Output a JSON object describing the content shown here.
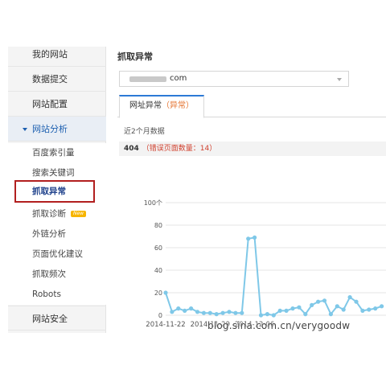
{
  "sidebar": {
    "items": [
      {
        "label": "我的网站"
      },
      {
        "label": "数据提交"
      },
      {
        "label": "网站配置"
      },
      {
        "label": "网站分析"
      },
      {
        "label": "网站安全"
      }
    ],
    "subitems": [
      {
        "label": "百度索引量"
      },
      {
        "label": "搜索关键词"
      },
      {
        "label": "抓取异常"
      },
      {
        "label": "抓取诊断",
        "badge": "New"
      },
      {
        "label": "外链分析"
      },
      {
        "label": "页面优化建议"
      },
      {
        "label": "抓取频次"
      },
      {
        "label": "Robots"
      }
    ]
  },
  "main": {
    "title": "抓取异常",
    "site_suffix": "com",
    "tab_label": "网址异常",
    "tab_paren": "（异常）",
    "period": "近2个月数据",
    "count_code": "404",
    "count_text": "（错误页面数量：14）"
  },
  "watermark": "blog.sina.com.cn/verygoodw",
  "colors": {
    "accent": "#1c5fb0",
    "highlight_border": "#b21f1f",
    "line": "#7fc8e8",
    "error": "#d0402e"
  },
  "chart_data": {
    "type": "line",
    "ylabel_ticks": [
      "100个",
      "80",
      "60",
      "40",
      "20",
      "0"
    ],
    "ylim": [
      0,
      100
    ],
    "x_tick_labels": [
      "2014-11-22",
      "2014-11-29",
      "2014-12-06"
    ],
    "series": [
      {
        "values": [
          20,
          3,
          6,
          4,
          6,
          3,
          2,
          2,
          1,
          2,
          3,
          2,
          2,
          68,
          69,
          0,
          1,
          0,
          4,
          4,
          6,
          7,
          1,
          9,
          12,
          13,
          1,
          8,
          5,
          16,
          12,
          4,
          5,
          6,
          8
        ]
      }
    ],
    "grid": true
  }
}
